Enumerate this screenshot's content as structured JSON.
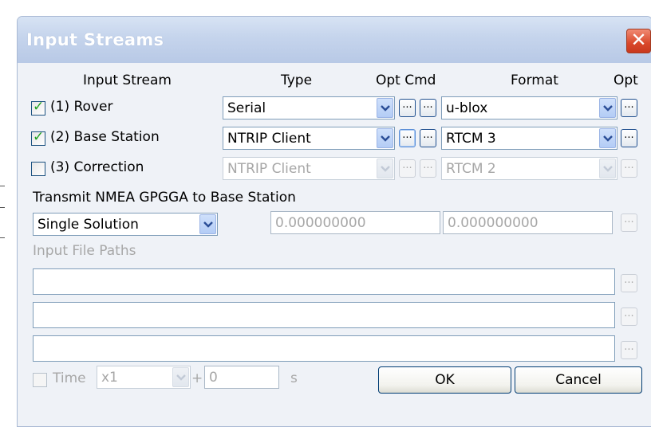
{
  "window": {
    "title": "Input Streams",
    "close_glyph": "✕"
  },
  "headers": {
    "input_stream": "Input Stream",
    "type": "Type",
    "opt_cmd": "Opt Cmd",
    "format": "Format",
    "opt": "Opt"
  },
  "streams": [
    {
      "label": "(1) Rover",
      "checked": true,
      "enabled": true,
      "type": "Serial",
      "format": "u-blox"
    },
    {
      "label": "(2) Base Station",
      "checked": true,
      "enabled": true,
      "type": "NTRIP Client",
      "format": "RTCM 3"
    },
    {
      "label": "(3) Correction",
      "checked": false,
      "enabled": false,
      "type": "NTRIP Client",
      "format": "RTCM 2"
    }
  ],
  "ellipsis": "...",
  "nmea": {
    "label": "Transmit NMEA GPGGA to Base Station",
    "mode": "Single Solution",
    "lat": "0.000000000",
    "lon": "0.000000000"
  },
  "input_file_paths": {
    "label": "Input File Paths",
    "paths": [
      "",
      "",
      ""
    ]
  },
  "time": {
    "label": "Time",
    "speed": "x1",
    "plus": "+",
    "offset": "0",
    "unit": "s"
  },
  "buttons": {
    "ok": "OK",
    "cancel": "Cancel"
  },
  "icons": {
    "checkbox_check": "checkmark-icon",
    "dropdown": "chevron-down-icon",
    "close": "close-icon"
  }
}
